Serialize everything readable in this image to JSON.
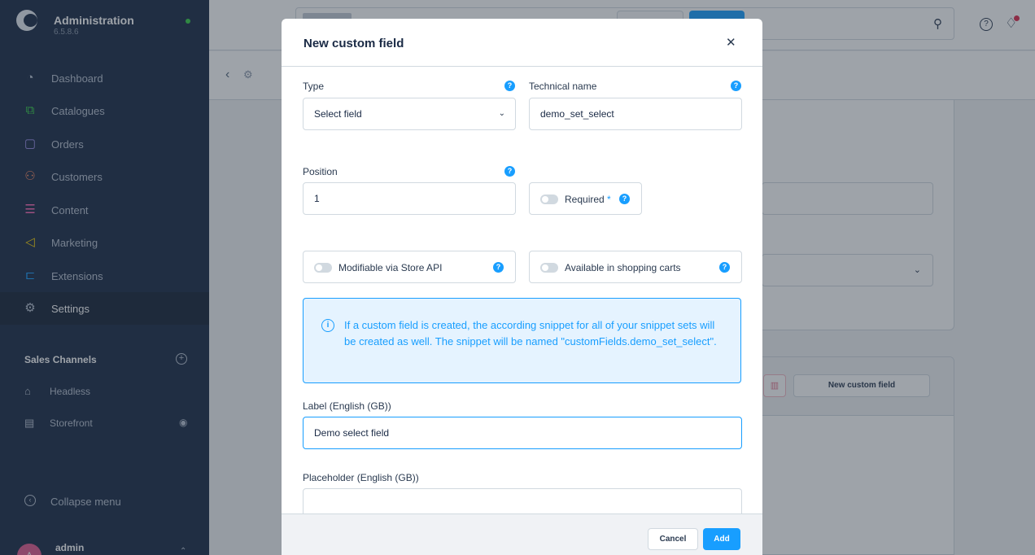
{
  "app": {
    "title": "Administration",
    "version": "6.5.8.6"
  },
  "sidebar": {
    "items": [
      {
        "label": "Dashboard",
        "icon": "dashboard-icon",
        "color": "#b6c0cf"
      },
      {
        "label": "Catalogues",
        "icon": "catalogues-icon",
        "color": "#37d046"
      },
      {
        "label": "Orders",
        "icon": "orders-icon",
        "color": "#a092f0"
      },
      {
        "label": "Customers",
        "icon": "customers-icon",
        "color": "#f88962"
      },
      {
        "label": "Content",
        "icon": "content-icon",
        "color": "#ff68b4"
      },
      {
        "label": "Marketing",
        "icon": "marketing-icon",
        "color": "#ffd700"
      },
      {
        "label": "Extensions",
        "icon": "extensions-icon",
        "color": "#189eff"
      },
      {
        "label": "Settings",
        "icon": "settings-icon",
        "color": "#b6c0cf",
        "active": true
      }
    ],
    "sales_channels_title": "Sales Channels",
    "channels": [
      {
        "label": "Headless",
        "icon": "basket-icon"
      },
      {
        "label": "Storefront",
        "icon": "storefront-icon"
      }
    ],
    "collapse_label": "Collapse menu",
    "user": {
      "initial": "A",
      "name": "admin"
    }
  },
  "toolbar": {
    "cancel_label": "Cancel",
    "save_label": "Save"
  },
  "background": {
    "new_custom_field_label": "New custom field"
  },
  "modal": {
    "title": "New custom field",
    "type_label": "Type",
    "type_value": "Select field",
    "technical_name_label": "Technical name",
    "technical_name_value": "demo_set_select",
    "position_label": "Position",
    "position_value": "1",
    "required_label": "Required",
    "required_asterisk": "*",
    "modifiable_label": "Modifiable via Store API",
    "shopping_carts_label": "Available in shopping carts",
    "alert_text": "If a custom field is created, the according snippet for all of your snippet sets will be created as well. The snippet will be named \"customFields.demo_set_select\".",
    "label_label": "Label (English (GB))",
    "label_value": "Demo select field",
    "placeholder_label": "Placeholder (English (GB))",
    "placeholder_value": "",
    "cancel_label": "Cancel",
    "add_label": "Add"
  },
  "colors": {
    "accent": "#189eff",
    "sidebar": "#1a2a45"
  }
}
